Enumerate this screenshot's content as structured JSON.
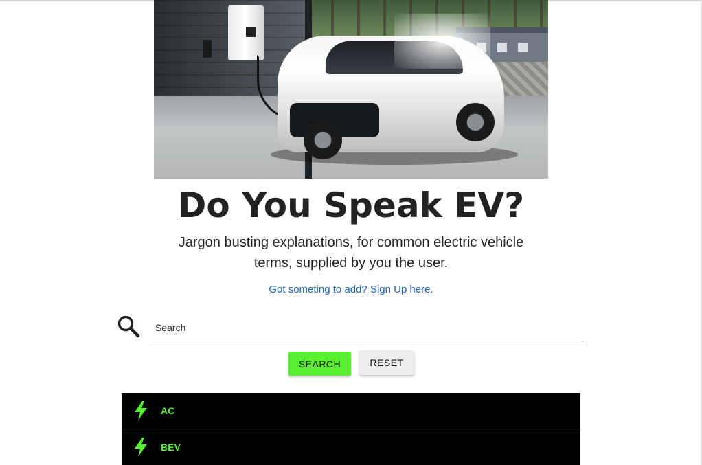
{
  "hero": {
    "image_alt": "White electric car charging in a garage"
  },
  "header": {
    "title": "Do You Speak EV?",
    "subtitle": "Jargon busting explanations, for common electric vehicle terms, supplied by you the user.",
    "signup_link": "Got someting to add? Sign Up here."
  },
  "search": {
    "placeholder": "Search",
    "value": "",
    "icon": "search-icon",
    "search_button": "SEARCH",
    "reset_button": "RESET"
  },
  "terms": [
    {
      "label": "AC",
      "icon": "bolt-icon"
    },
    {
      "label": "BEV",
      "icon": "bolt-icon"
    }
  ],
  "colors": {
    "accent": "#57ef2e",
    "link": "#1b64b5",
    "list_bg": "#000000",
    "text": "#222222"
  }
}
